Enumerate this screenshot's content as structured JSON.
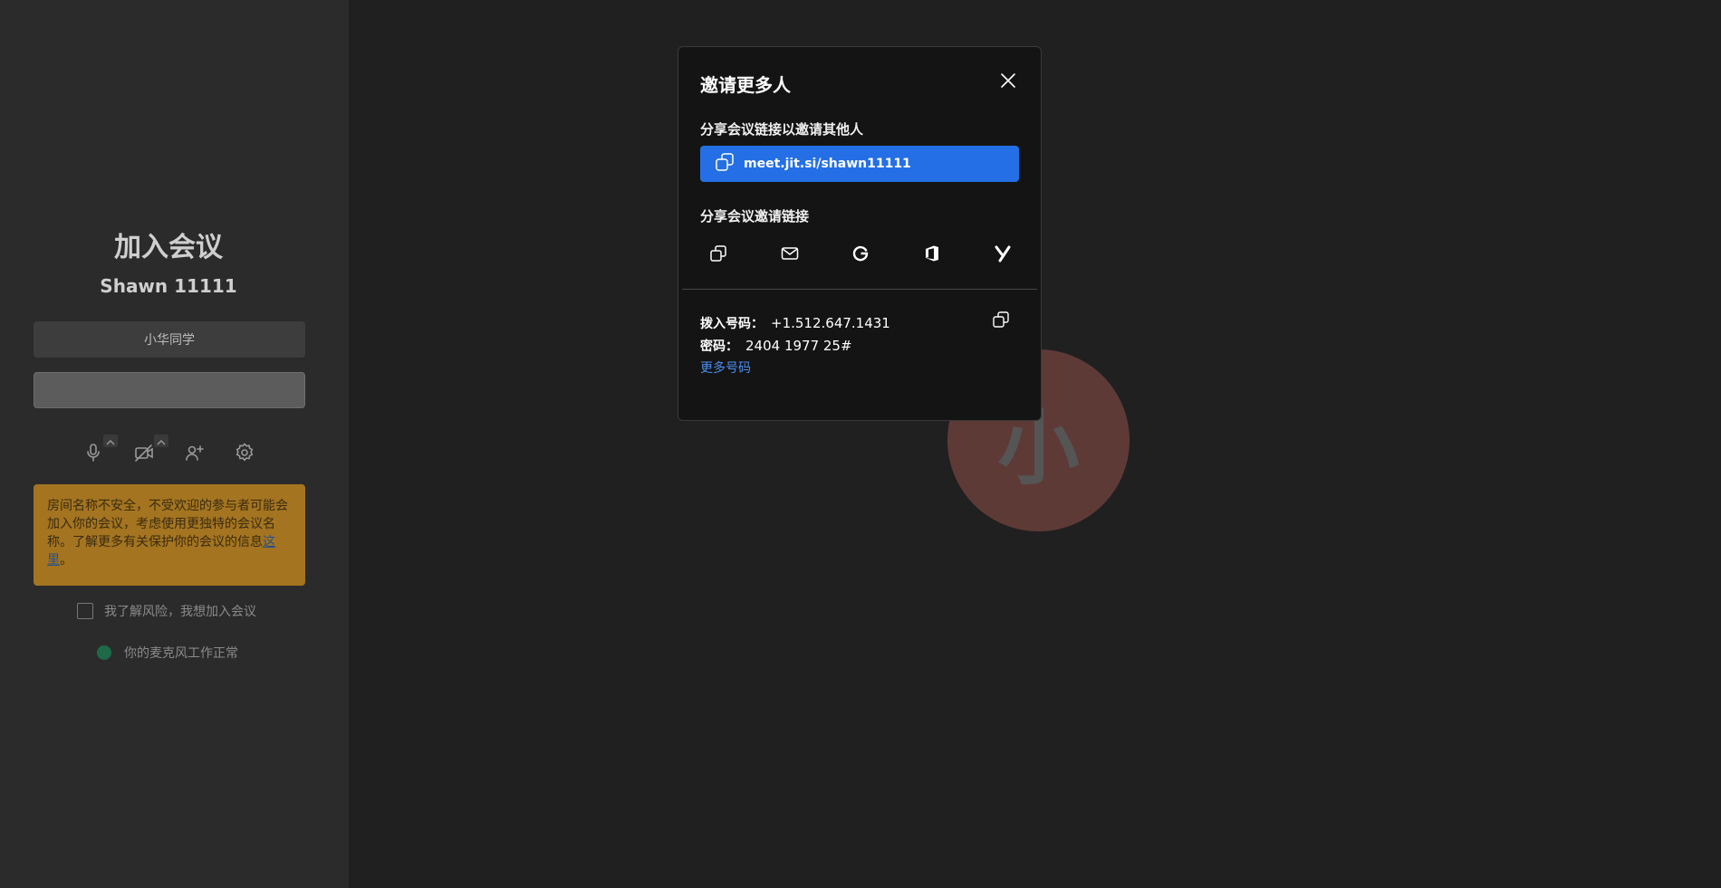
{
  "prejoin": {
    "title": "加入会议",
    "room_name": "Shawn 11111",
    "name_input_value": "小华同学",
    "join_button_label": "",
    "warning_text": "房间名称不安全，不受欢迎的参与者可能会加入你的会议，考虑使用更独特的会议名称。了解更多有关保护你的会议的信息",
    "warning_link_text": "这里",
    "warning_period": "。",
    "consent_label": "我了解风险，我想加入会议",
    "mic_status": "你的麦克风工作正常",
    "status_color": "#1e6a48"
  },
  "toolbar": {
    "icons": [
      "microphone-icon",
      "camera-off-icon",
      "invite-icon",
      "settings-icon"
    ]
  },
  "stage": {
    "avatar_initial": "小",
    "avatar_color": "#5e3a37"
  },
  "dialog": {
    "title": "邀请更多人",
    "share_link_label": "分享会议链接以邀请其他人",
    "meeting_link": "meet.jit.si/shawn11111",
    "share_invite_label": "分享会议邀请链接",
    "share_icons": [
      "copy-icon",
      "email-icon",
      "google-icon",
      "office-icon",
      "yahoo-icon"
    ],
    "dial_in_label": "拨入号码：",
    "dial_in_number": "+1.512.647.1431",
    "pin_label": "密码：",
    "pin_value": "2404 1977 25#",
    "more_numbers": "更多号码",
    "accent_color": "#246fe5"
  }
}
